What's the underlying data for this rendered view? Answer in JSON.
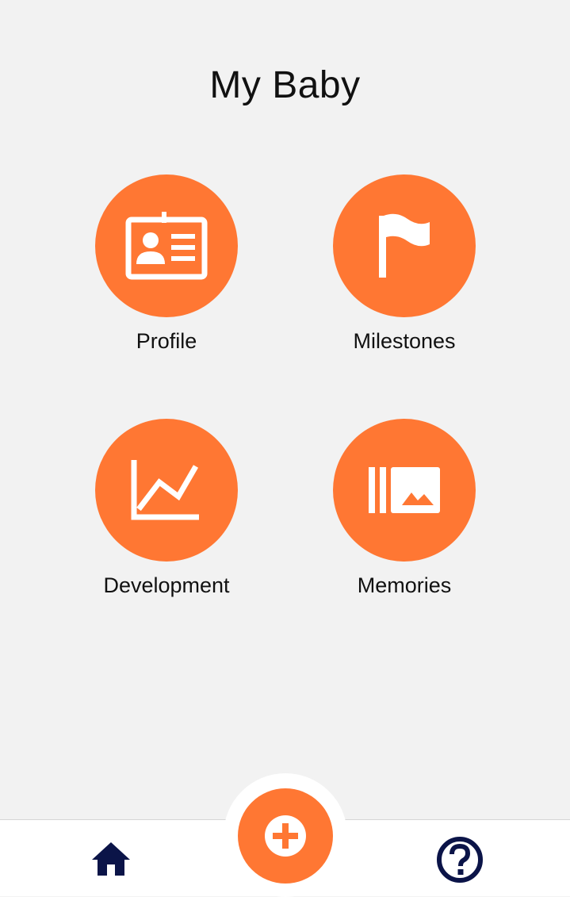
{
  "header": {
    "title": "My Baby"
  },
  "tiles": [
    {
      "label": "Profile",
      "icon": "id-card-icon"
    },
    {
      "label": "Milestones",
      "icon": "flag-icon"
    },
    {
      "label": "Development",
      "icon": "line-chart-icon"
    },
    {
      "label": "Memories",
      "icon": "photo-library-icon"
    }
  ],
  "bottom_nav": {
    "home_icon": "home-icon",
    "add_icon": "plus-icon",
    "help_icon": "help-circle-icon"
  },
  "colors": {
    "accent": "#ff7733",
    "nav_icon": "#0b1448",
    "background": "#f2f2f2",
    "bar": "#ffffff"
  }
}
